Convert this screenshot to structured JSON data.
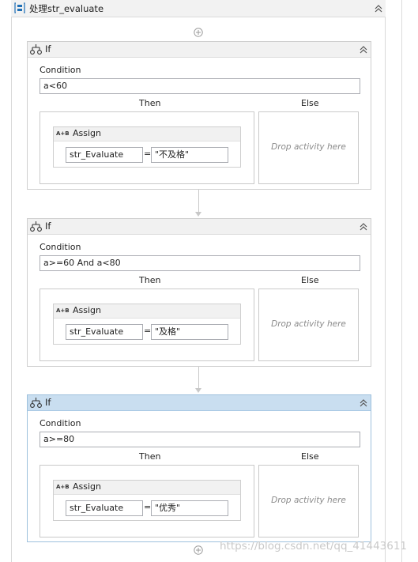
{
  "sequence": {
    "title": "处理str_evaluate"
  },
  "if_blocks": [
    {
      "title": "If",
      "condition_label": "Condition",
      "condition": "a<60",
      "then_label": "Then",
      "else_label": "Else",
      "else_placeholder": "Drop activity here",
      "assign": {
        "title": "Assign",
        "icon_text": "A+B",
        "to": "str_Evaluate",
        "equals": "=",
        "value": "\"不及格\""
      }
    },
    {
      "title": "If",
      "condition_label": "Condition",
      "condition": "a>=60 And a<80",
      "then_label": "Then",
      "else_label": "Else",
      "else_placeholder": "Drop activity here",
      "assign": {
        "title": "Assign",
        "icon_text": "A+B",
        "to": "str_Evaluate",
        "equals": "=",
        "value": "\"及格\""
      }
    },
    {
      "title": "If",
      "condition_label": "Condition",
      "condition": "a>=80",
      "then_label": "Then",
      "else_label": "Else",
      "else_placeholder": "Drop activity here",
      "assign": {
        "title": "Assign",
        "icon_text": "A+B",
        "to": "str_Evaluate",
        "equals": "=",
        "value": "\"优秀\""
      }
    }
  ],
  "watermark": "https://blog.csdn.net/qq_41443611"
}
